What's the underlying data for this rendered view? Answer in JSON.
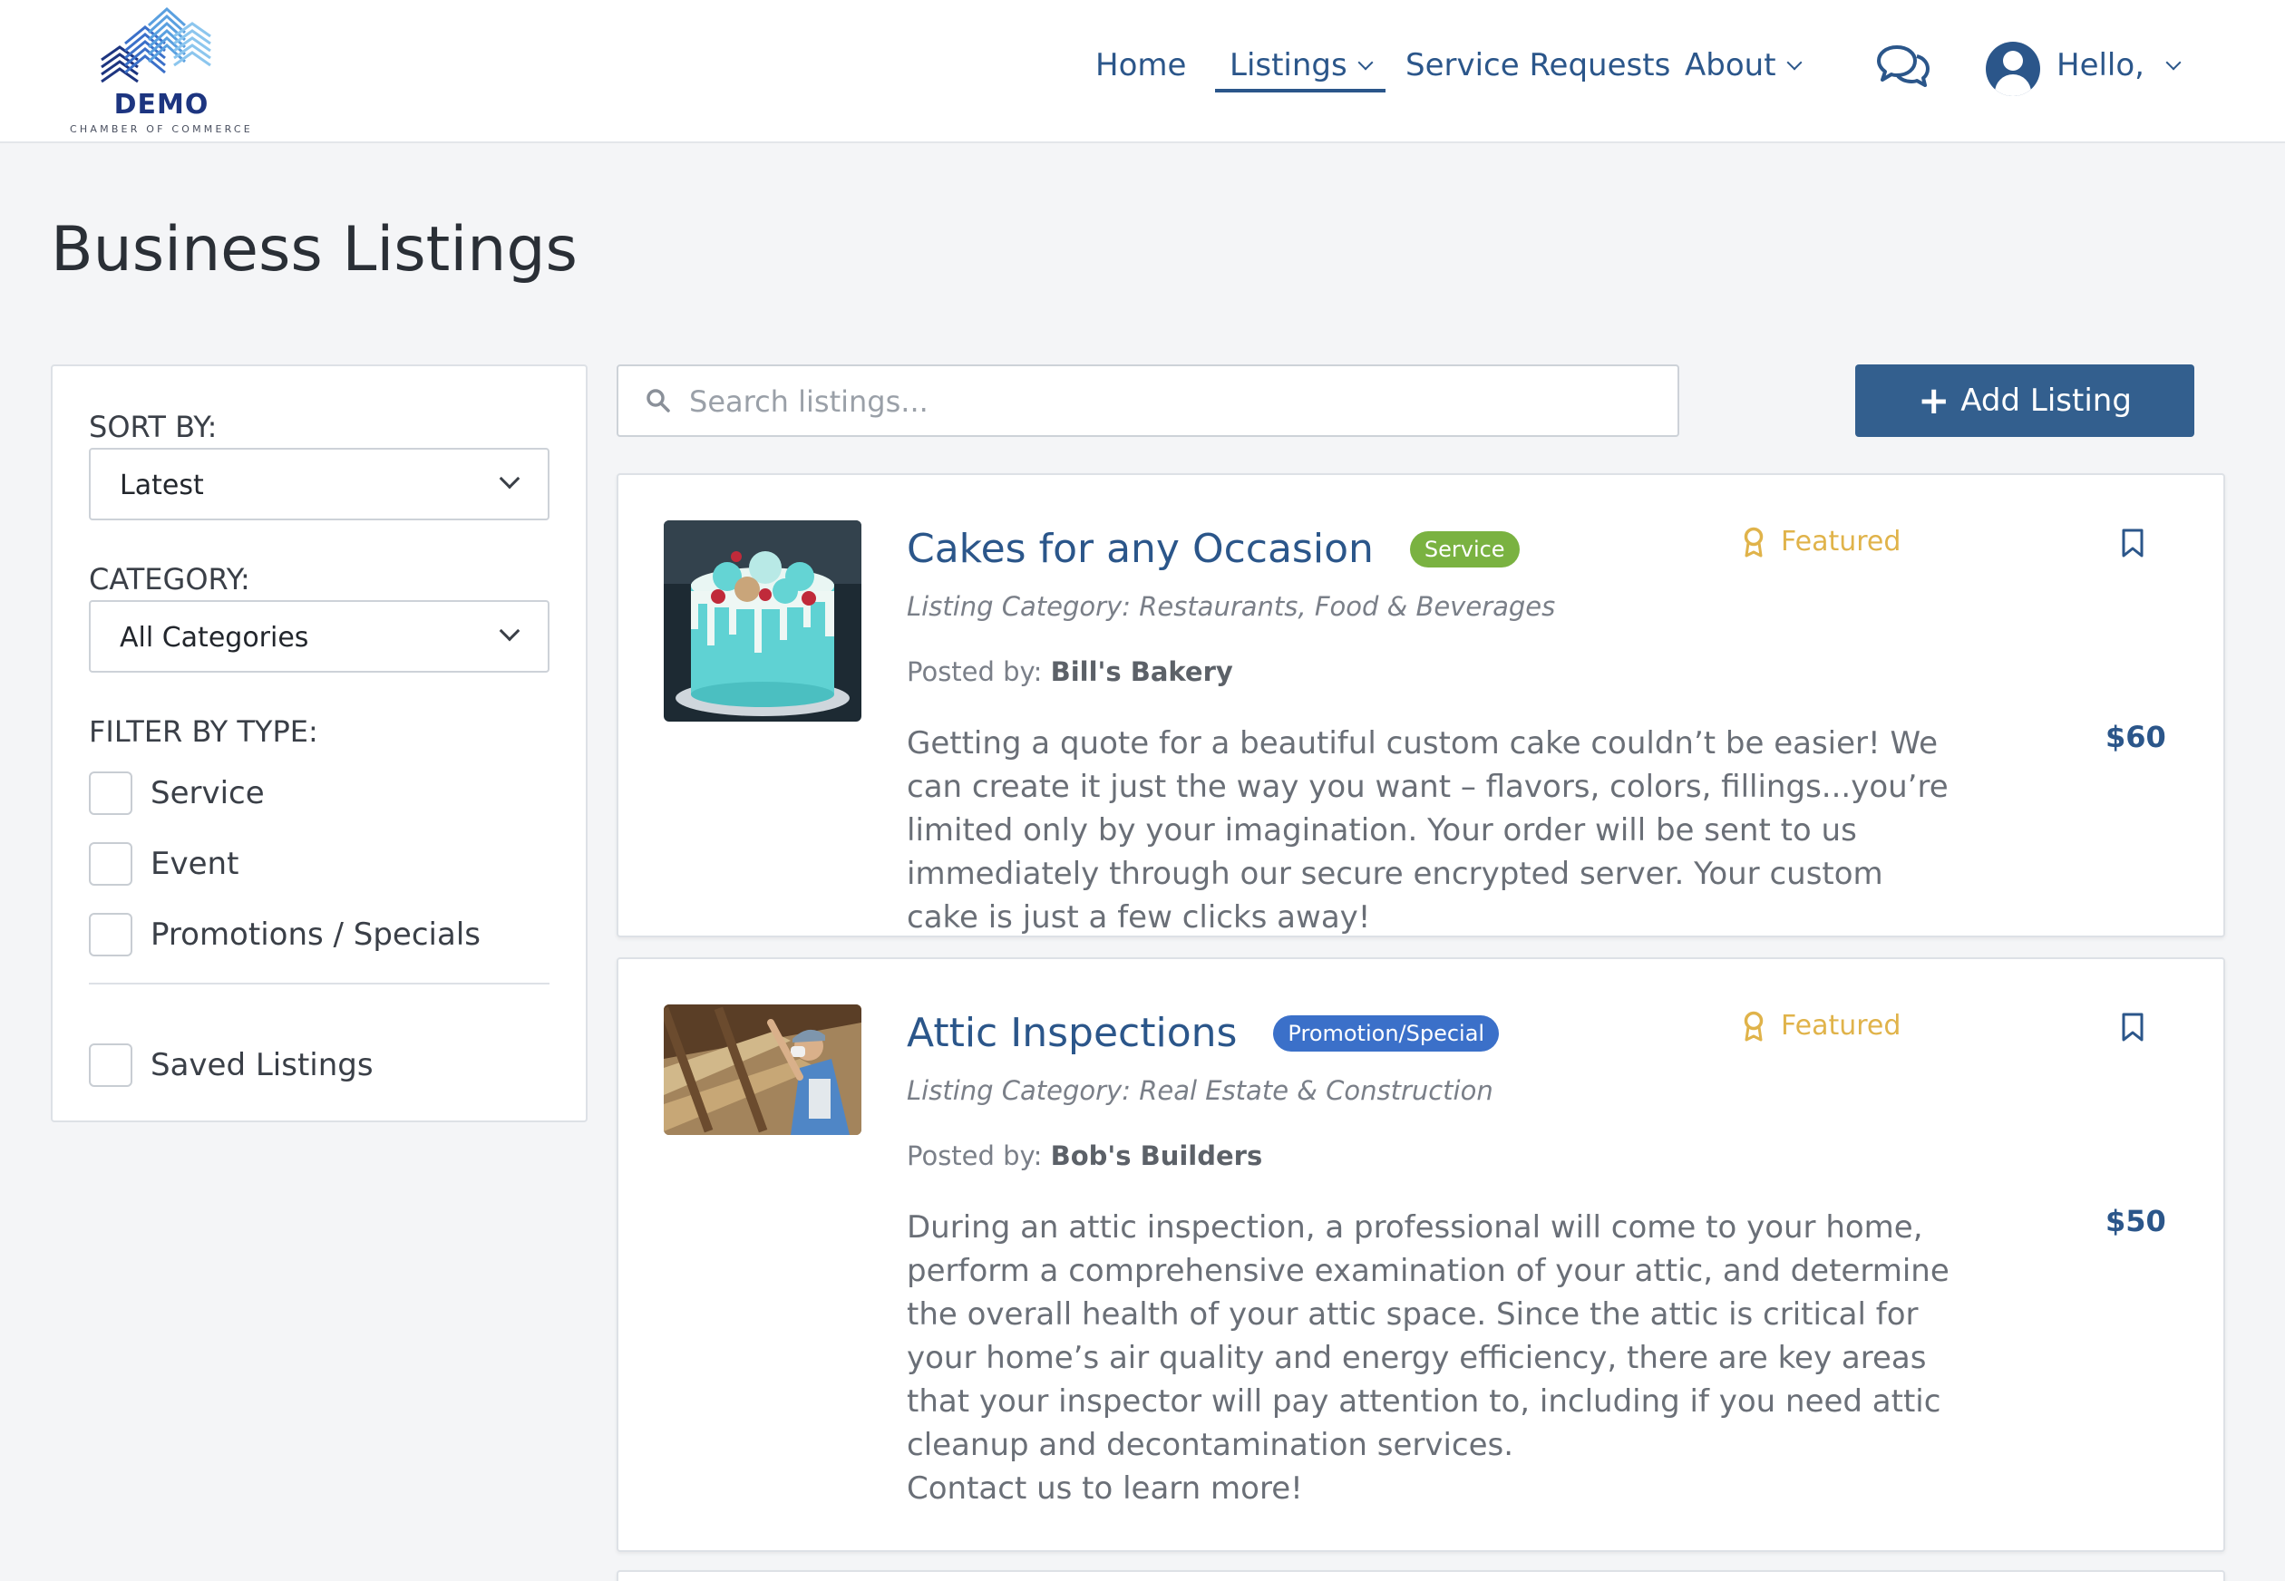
{
  "brand": {
    "name": "DEMO",
    "subtitle": "CHAMBER OF COMMERCE"
  },
  "nav": {
    "home": "Home",
    "listings": "Listings",
    "service_requests": "Service Requests",
    "about": "About",
    "greeting": "Hello,"
  },
  "page": {
    "title": "Business Listings"
  },
  "sidebar": {
    "sort_label": "SORT BY:",
    "sort_value": "Latest",
    "category_label": "CATEGORY:",
    "category_value": "All Categories",
    "filter_label": "FILTER BY TYPE:",
    "filters": [
      "Service",
      "Event",
      "Promotions / Specials"
    ],
    "saved": "Saved Listings"
  },
  "search": {
    "placeholder": "Search listings..."
  },
  "add_button": {
    "label": "Add Listing"
  },
  "listings": [
    {
      "title": "Cakes for any Occasion",
      "badge": "Service",
      "featured": "Featured",
      "category": "Listing Category: Restaurants, Food & Beverages",
      "posted_prefix": "Posted by: ",
      "posted_by": "Bill's Bakery",
      "description": "Getting a quote for a beautiful custom cake couldn’t be easier! We can create it just the way you want – flavors, colors, fillings...you’re limited only by your imagination. Your order will be sent to us immediately through our secure encrypted server. Your custom cake is just a few clicks away!",
      "price": "$60"
    },
    {
      "title": "Attic Inspections",
      "badge": "Promotion/Special",
      "featured": "Featured",
      "category": "Listing Category: Real Estate & Construction",
      "posted_prefix": "Posted by: ",
      "posted_by": "Bob's Builders",
      "description": "During an attic inspection, a professional will come to your home, perform a comprehensive examination of your attic, and determine the overall health of your attic space. Since the attic is critical for your home’s air quality and energy efficiency, there are key areas that your inspector will pay attention to, including if you need attic cleanup and decontamination services.",
      "description_extra": "Contact us to learn more!",
      "price": "$50"
    }
  ],
  "colors": {
    "primary": "#2b568a",
    "button": "#335f8e",
    "service_badge": "#7ab241",
    "promo_badge": "#3b70c9",
    "featured": "#e0b34a"
  },
  "icons": [
    "chat-bubbles-icon",
    "user-avatar-icon",
    "search-icon",
    "plus-icon",
    "award-icon",
    "bookmark-icon",
    "chevron-down-icon"
  ]
}
